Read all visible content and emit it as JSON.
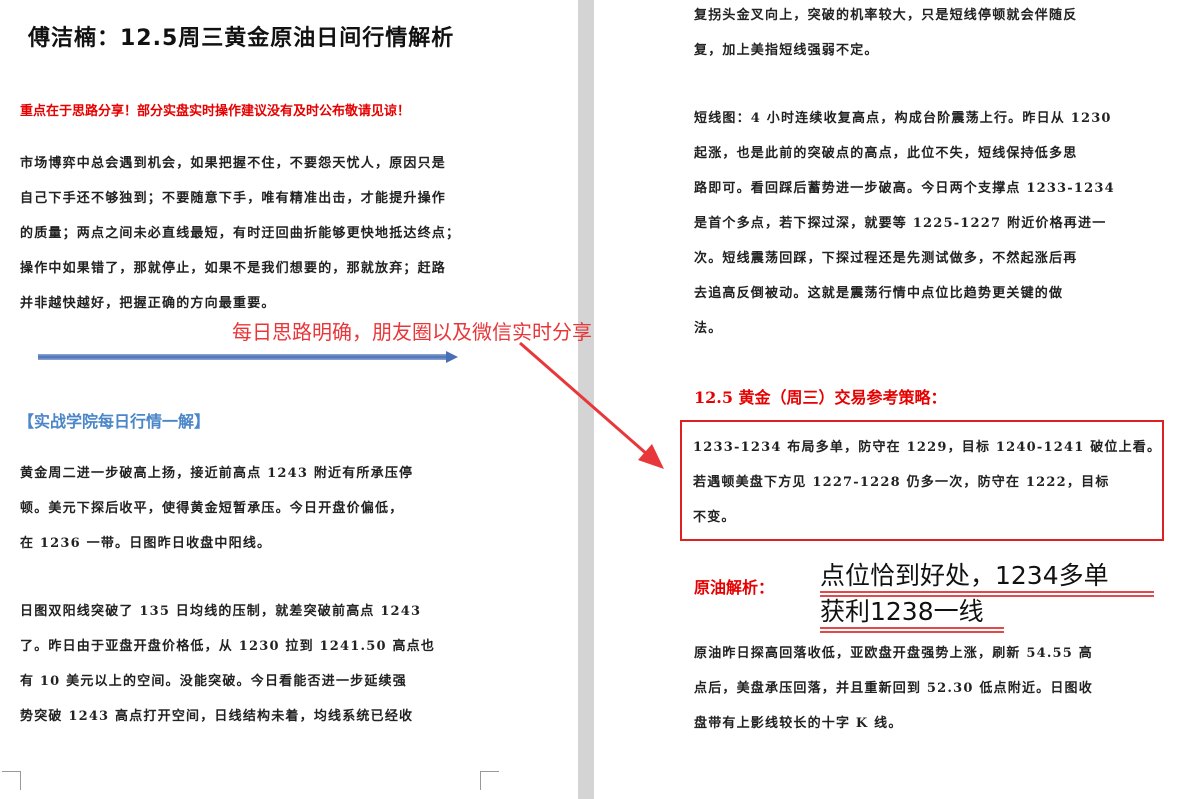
{
  "left_page": {
    "title": "傅洁楠：12.5周三黄金原油日间行情解析",
    "notice": "重点在于思路分享！部分实盘实时操作建议没有及时公布敬请见谅！",
    "intro_lines": [
      "市场博弈中总会遇到机会，如果把握不住，不要怨天忧人，原因只是",
      "自己下手还不够独到；不要随意下手，唯有精准出击，才能提升操作",
      "的质量；两点之间未必直线最短，有时迂回曲折能够更快地抵达终点；",
      "操作中如果错了，那就停止，如果不是我们想要的，那就放弃；赶路",
      "并非越快越好，把握正确的方向最重要。"
    ],
    "section_title": "【实战学院每日行情一解】",
    "gold_lines_1": [
      "黄金周二进一步破高上扬，接近前高点 1243 附近有所承压停",
      "顿。美元下探后收平，使得黄金短暂承压。今日开盘价偏低，",
      "在 1236 一带。日图昨日收盘中阳线。"
    ],
    "gold_lines_2": [
      "日图双阳线突破了 135 日均线的压制，就差突破前高点 1243",
      "了。昨日由于亚盘开盘价格低，从 1230 拉到 1241.50 高点也",
      "有 10 美元以上的空间。没能突破。今日看能否进一步延续强",
      "势突破 1243 高点打开空间，日线结构未着，均线系统已经收"
    ]
  },
  "right_page": {
    "top_lines": [
      "复拐头金叉向上，突破的机率较大，只是短线停顿就会伴随反",
      "复，加上美指短线强弱不定。"
    ],
    "short_term_lines": [
      "短线图：4 小时连续收复高点，构成台阶震荡上行。昨日从 1230",
      "起涨，也是此前的突破点的高点，此位不失，短线保持低多思",
      "路即可。看回踩后蓄势进一步破高。今日两个支撑点 1233-1234",
      "是首个多点，若下探过深，就要等 1225-1227 附近价格再进一",
      "次。短线震荡回踩，下探过程还是先测试做多，不然起涨后再",
      "去追高反倒被动。这就是震荡行情中点位比趋势更关键的做",
      "法。"
    ],
    "strategy_title": "12.5 黄金（周三）交易参考策略：",
    "strategy_lines": [
      "1233-1234 布局多单，防守在 1229，目标 1240-1241 破位上看。",
      "若遇顿美盘下方见 1227-1228 仍多一次，防守在 1222，目标",
      "不变。"
    ],
    "oil_title": "原油解析：",
    "oil_lines": [
      "原油昨日探高回落收低，亚欧盘开盘强势上涨，刷新 54.55 高",
      "点后，美盘承压回落，并且重新回到 52.30 低点附近。日图收",
      "盘带有上影线较长的十字 K 线。"
    ]
  },
  "annotations": {
    "overlay_note": "每日思路明确，朋友圈以及微信实时分享",
    "hand_note_line1": "点位恰到好处，1234多单",
    "hand_note_line2": "获利1238一线",
    "arrow_color": "#e8373a",
    "underline_color": "#e04a4a",
    "box_color": "#e02020"
  }
}
